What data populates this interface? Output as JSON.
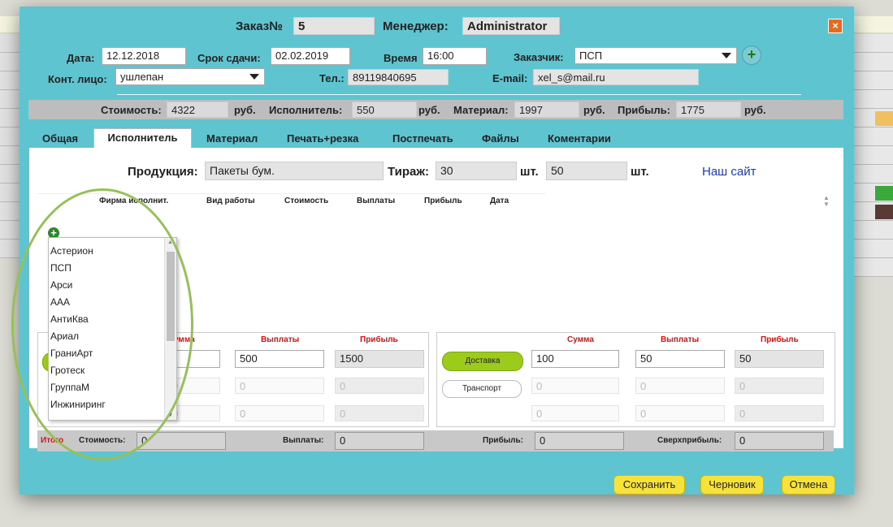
{
  "header": {
    "order_label": "Заказ№",
    "order_no": "5",
    "manager_label": "Менеджер:",
    "manager": "Administrator",
    "close_glyph": "×"
  },
  "form": {
    "date_label": "Дата:",
    "date": "12.12.2018",
    "deadline_label": "Срок сдачи:",
    "deadline": "02.02.2019",
    "time_label": "Время",
    "time": "16:00",
    "customer_label": "Заказчик:",
    "customer": "ПСП",
    "contact_label": "Конт. лицо:",
    "contact": "ушлепан",
    "phone_label": "Тел.:",
    "phone": "89119840695",
    "email_label": "E-mail:",
    "email": "xel_s@mail.ru",
    "add_icon": "plus-icon"
  },
  "summary": {
    "cost_label": "Стоимость:",
    "cost": "4322",
    "rub": "руб.",
    "executor_label": "Исполнитель:",
    "executor": "550",
    "material_label": "Материал:",
    "material": "1997",
    "profit_label": "Прибыль:",
    "profit": "1775"
  },
  "tabs": [
    "Общая",
    "Исполнитель",
    "Материал",
    "Печать+резка",
    "Постпечать",
    "Файлы",
    "Коментарии"
  ],
  "panel": {
    "product_label": "Продукция:",
    "product": "Пакеты бум.",
    "run_label": "Тираж:",
    "run1": "30",
    "pcs": "шт.",
    "run2": "50",
    "site_link": "Наш сайт",
    "columns": [
      "Фирма исполнит.",
      "Вид работы",
      "Стоимость",
      "Выплаты",
      "Прибыль",
      "Дата"
    ]
  },
  "left_section": {
    "hdr_sum_partial": "умма",
    "hdr_pay": "Выплаты",
    "hdr_profit": "Прибыль",
    "pay1": "500",
    "profit1": "1500",
    "zero": "0"
  },
  "right_section": {
    "hdr_sum": "Сумма",
    "hdr_pay": "Выплаты",
    "hdr_profit": "Прибыль",
    "delivery_btn": "Доставка",
    "transport_btn": "Транспорт",
    "sum1": "100",
    "pay1": "50",
    "profit1": "50",
    "zero": "0"
  },
  "totals": {
    "itogo": "Итого",
    "cost_label": "Стоимость:",
    "cost": "0",
    "pay_label": "Выплаты:",
    "pay": "0",
    "profit_label": "Прибыль:",
    "profit": "0",
    "super_label": "Сверхприбыль:",
    "super": "0"
  },
  "dropdown": {
    "items": [
      "Астерион",
      "ПСП",
      "Арси",
      "ААА",
      "АнтиКва",
      "Ариал",
      "ГраниАрт",
      "Гротеск",
      "ГруппаМ",
      "Инжиниринг"
    ]
  },
  "buttons": {
    "save": "Сохранить",
    "draft": "Черновик",
    "cancel": "Отмена"
  },
  "colors": {
    "modal_bg": "#5ec4cf",
    "accent_green": "#9ccb1b",
    "button_yellow": "#f6e23a",
    "annotation": "#97c05a"
  }
}
